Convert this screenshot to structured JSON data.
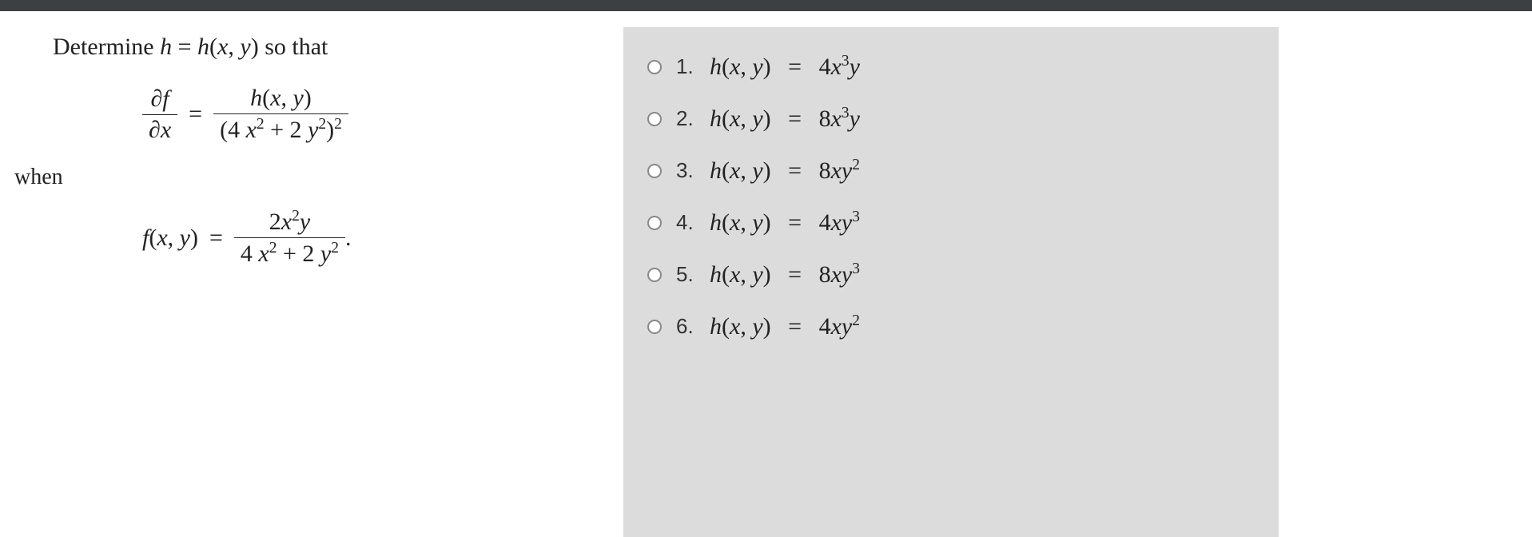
{
  "question": {
    "intro_prefix": "Determine ",
    "intro_eq_lhs": "h",
    "intro_eq_rhs": "h(x, y)",
    "intro_suffix": " so that",
    "partial_lhs_num": "∂f",
    "partial_lhs_den": "∂x",
    "partial_rhs_num": "h(x, y)",
    "partial_rhs_den": "(4 x² + 2 y²)²",
    "when": "when",
    "f_lhs": "f(x, y)",
    "f_rhs_num": "2x²y",
    "f_rhs_den": "4 x² + 2 y²"
  },
  "options": [
    {
      "num": "1.",
      "lhs": "h(x, y)",
      "rhs": "4x³y"
    },
    {
      "num": "2.",
      "lhs": "h(x, y)",
      "rhs": "8x³y"
    },
    {
      "num": "3.",
      "lhs": "h(x, y)",
      "rhs": "8xy²"
    },
    {
      "num": "4.",
      "lhs": "h(x, y)",
      "rhs": "4xy³"
    },
    {
      "num": "5.",
      "lhs": "h(x, y)",
      "rhs": "8xy³"
    },
    {
      "num": "6.",
      "lhs": "h(x, y)",
      "rhs": "4xy²"
    }
  ],
  "equals": "="
}
